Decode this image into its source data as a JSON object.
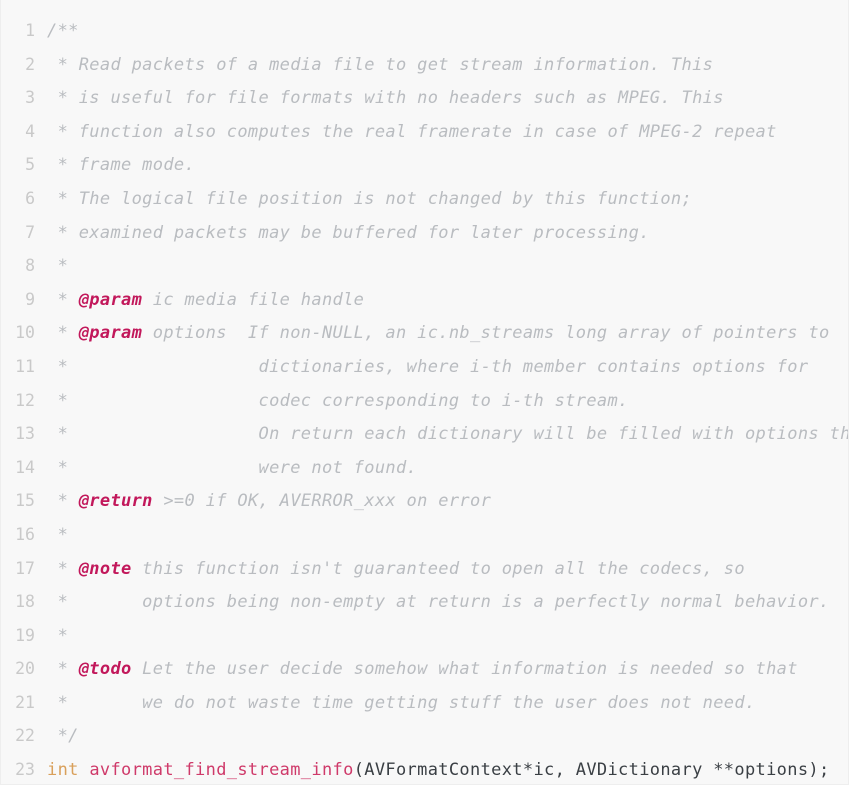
{
  "editor": {
    "language": "C",
    "background_color": "#f8f8f8",
    "border_color": "#eeeeee",
    "line_number_color": "#c9c9c9",
    "first_line_number": 1,
    "last_line_number": 23
  },
  "colors": {
    "comment": "#b9bcc0",
    "doc_tag": "#c2185b",
    "keyword": "#d9a05b",
    "function_name": "#cf3a6a",
    "plain": "#3a3f44"
  },
  "lines": [
    {
      "number": "1",
      "text": "/**",
      "tokens": [
        {
          "kind": "comment",
          "text": "/**"
        }
      ]
    },
    {
      "number": "2",
      "text": " * Read packets of a media file to get stream information. This",
      "tokens": [
        {
          "kind": "comment",
          "text": " * Read packets of a media file to get stream information. This"
        }
      ]
    },
    {
      "number": "3",
      "text": " * is useful for file formats with no headers such as MPEG. This",
      "tokens": [
        {
          "kind": "comment",
          "text": " * is useful for file formats with no headers such as MPEG. This"
        }
      ]
    },
    {
      "number": "4",
      "text": " * function also computes the real framerate in case of MPEG-2 repeat",
      "tokens": [
        {
          "kind": "comment",
          "text": " * function also computes the real framerate in case of MPEG-2 repeat"
        }
      ]
    },
    {
      "number": "5",
      "text": " * frame mode.",
      "tokens": [
        {
          "kind": "comment",
          "text": " * frame mode."
        }
      ]
    },
    {
      "number": "6",
      "text": " * The logical file position is not changed by this function;",
      "tokens": [
        {
          "kind": "comment",
          "text": " * The logical file position is not changed by this function;"
        }
      ]
    },
    {
      "number": "7",
      "text": " * examined packets may be buffered for later processing.",
      "tokens": [
        {
          "kind": "comment",
          "text": " * examined packets may be buffered for later processing."
        }
      ]
    },
    {
      "number": "8",
      "text": " *",
      "tokens": [
        {
          "kind": "comment",
          "text": " *"
        }
      ]
    },
    {
      "number": "9",
      "text": " * @param ic media file handle",
      "tokens": [
        {
          "kind": "comment",
          "text": " * "
        },
        {
          "kind": "doctag",
          "text": "@param"
        },
        {
          "kind": "comment",
          "text": " ic media file handle"
        }
      ]
    },
    {
      "number": "10",
      "text": " * @param options  If non-NULL, an ic.nb_streams long array of pointers to",
      "tokens": [
        {
          "kind": "comment",
          "text": " * "
        },
        {
          "kind": "doctag",
          "text": "@param"
        },
        {
          "kind": "comment",
          "text": " options  If non-NULL, an ic.nb_streams long array of pointers to"
        }
      ]
    },
    {
      "number": "11",
      "text": " *                  dictionaries, where i-th member contains options for",
      "tokens": [
        {
          "kind": "comment",
          "text": " *                  dictionaries, where i-th member contains options for"
        }
      ]
    },
    {
      "number": "12",
      "text": " *                  codec corresponding to i-th stream.",
      "tokens": [
        {
          "kind": "comment",
          "text": " *                  codec corresponding to i-th stream."
        }
      ]
    },
    {
      "number": "13",
      "text": " *                  On return each dictionary will be filled with options that",
      "tokens": [
        {
          "kind": "comment",
          "text": " *                  On return each dictionary will be filled with options that"
        }
      ]
    },
    {
      "number": "14",
      "text": " *                  were not found.",
      "tokens": [
        {
          "kind": "comment",
          "text": " *                  were not found."
        }
      ]
    },
    {
      "number": "15",
      "text": " * @return >=0 if OK, AVERROR_xxx on error",
      "tokens": [
        {
          "kind": "comment",
          "text": " * "
        },
        {
          "kind": "doctag",
          "text": "@return"
        },
        {
          "kind": "comment",
          "text": " >=0 if OK, AVERROR_xxx on error"
        }
      ]
    },
    {
      "number": "16",
      "text": " *",
      "tokens": [
        {
          "kind": "comment",
          "text": " *"
        }
      ]
    },
    {
      "number": "17",
      "text": " * @note this function isn't guaranteed to open all the codecs, so",
      "tokens": [
        {
          "kind": "comment",
          "text": " * "
        },
        {
          "kind": "doctag",
          "text": "@note"
        },
        {
          "kind": "comment",
          "text": " this function isn't guaranteed to open all the codecs, so"
        }
      ]
    },
    {
      "number": "18",
      "text": " *       options being non-empty at return is a perfectly normal behavior.",
      "tokens": [
        {
          "kind": "comment",
          "text": " *       options being non-empty at return is a perfectly normal behavior."
        }
      ]
    },
    {
      "number": "19",
      "text": " *",
      "tokens": [
        {
          "kind": "comment",
          "text": " *"
        }
      ]
    },
    {
      "number": "20",
      "text": " * @todo Let the user decide somehow what information is needed so that",
      "tokens": [
        {
          "kind": "comment",
          "text": " * "
        },
        {
          "kind": "doctag",
          "text": "@todo"
        },
        {
          "kind": "comment",
          "text": " Let the user decide somehow what information is needed so that"
        }
      ]
    },
    {
      "number": "21",
      "text": " *       we do not waste time getting stuff the user does not need.",
      "tokens": [
        {
          "kind": "comment",
          "text": " *       we do not waste time getting stuff the user does not need."
        }
      ]
    },
    {
      "number": "22",
      "text": " */",
      "tokens": [
        {
          "kind": "comment",
          "text": " */"
        }
      ]
    },
    {
      "number": "23",
      "text": "int avformat_find_stream_info(AVFormatContext*ic, AVDictionary **options);",
      "tokens": [
        {
          "kind": "keyword",
          "text": "int"
        },
        {
          "kind": "plain",
          "text": " "
        },
        {
          "kind": "fname",
          "text": "avformat_find_stream_info"
        },
        {
          "kind": "plain",
          "text": "(AVFormatContext*ic, AVDictionary **options);"
        }
      ]
    }
  ]
}
